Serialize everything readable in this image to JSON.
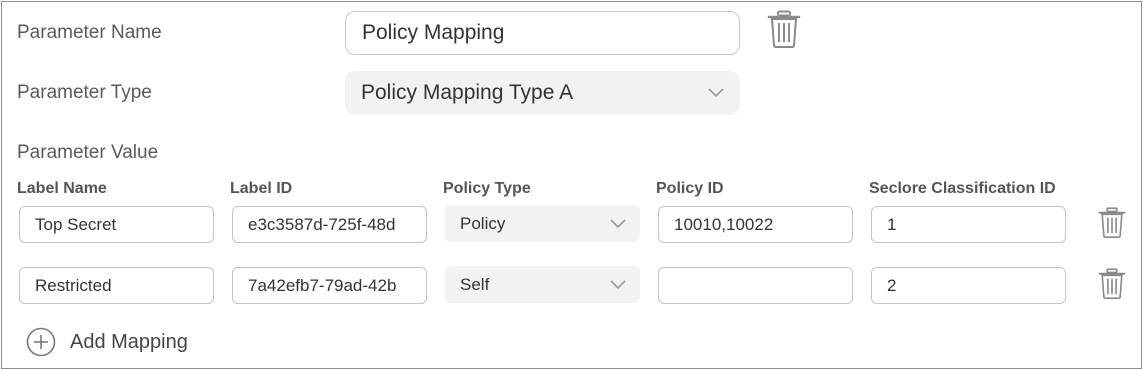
{
  "parameter_name": {
    "label": "Parameter Name",
    "value": "Policy Mapping"
  },
  "parameter_type": {
    "label": "Parameter Type",
    "value": "Policy Mapping Type A"
  },
  "parameter_value": {
    "label": "Parameter Value",
    "columns": [
      "Label Name",
      "Label ID",
      "Policy Type",
      "Policy ID",
      "Seclore Classification ID"
    ],
    "rows": [
      {
        "label_name": "Top Secret",
        "label_id": "e3c3587d-725f-48d",
        "policy_type": "Policy",
        "policy_id": "10010,10022",
        "seclore_id": "1"
      },
      {
        "label_name": "Restricted",
        "label_id": "7a42efb7-79ad-42b",
        "policy_type": "Self",
        "policy_id": "",
        "seclore_id": "2"
      }
    ]
  },
  "add_mapping_label": "Add Mapping",
  "icons": {
    "delete": "trash-icon",
    "dropdown": "chevron-down-icon",
    "add": "plus-circle-icon"
  },
  "colors": {
    "border": "#8f8f8f",
    "select_bg": "#f2f2f2",
    "input_border": "#c4c4c4",
    "icon": "#8a8a8a"
  }
}
